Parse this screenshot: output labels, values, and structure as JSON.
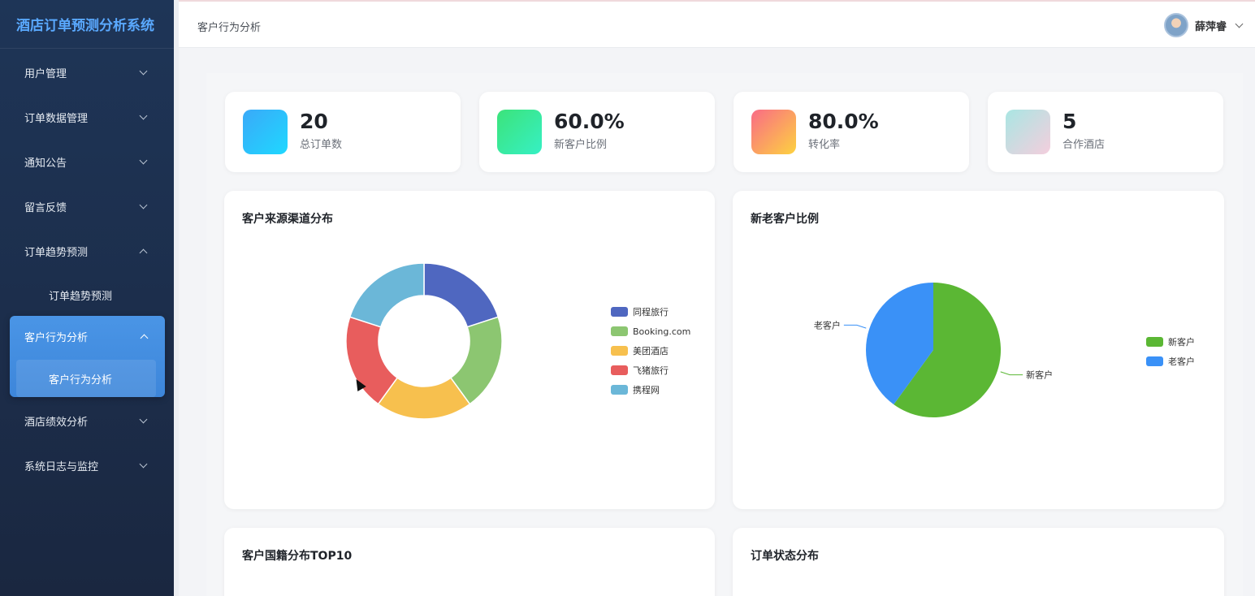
{
  "app": {
    "title": "酒店订单预测分析系统"
  },
  "sidebar": {
    "items": [
      {
        "label": "用户管理"
      },
      {
        "label": "订单数据管理"
      },
      {
        "label": "通知公告"
      },
      {
        "label": "留言反馈"
      },
      {
        "label": "订单趋势预测",
        "sub": "订单趋势预测"
      },
      {
        "label": "客户行为分析",
        "sub": "客户行为分析"
      },
      {
        "label": "酒店绩效分析"
      },
      {
        "label": "系统日志与监控"
      }
    ]
  },
  "header": {
    "breadcrumb": "客户行为分析",
    "user_name": "薛萍睿"
  },
  "stats": [
    {
      "value": "20",
      "label": "总订单数",
      "gradient": [
        "#3aa9f8",
        "#1fd8ff"
      ]
    },
    {
      "value": "60.0%",
      "label": "新客户比例",
      "gradient": [
        "#3ce37a",
        "#36f0c4"
      ]
    },
    {
      "value": "80.0%",
      "label": "转化率",
      "gradient": [
        "#f96b86",
        "#fdd240"
      ]
    },
    {
      "value": "5",
      "label": "合作酒店",
      "gradient": [
        "#a9e6e3",
        "#f4cedd"
      ]
    }
  ],
  "cards": {
    "channel": {
      "title": "客户来源渠道分布"
    },
    "newold": {
      "title": "新老客户比例"
    },
    "nationality": {
      "title": "客户国籍分布TOP10"
    },
    "status": {
      "title": "订单状态分布"
    }
  },
  "chart_data": [
    {
      "type": "pie",
      "title": "客户来源渠道分布",
      "donut": true,
      "categories": [
        "同程旅行",
        "Booking.com",
        "美团酒店",
        "飞猪旅行",
        "携程网"
      ],
      "values": [
        4,
        4,
        4,
        4,
        4
      ],
      "colors": [
        "#4f67c0",
        "#8cc671",
        "#f7c04e",
        "#e85d5d",
        "#6bb7d8"
      ],
      "legend": "right"
    },
    {
      "type": "pie",
      "title": "新老客户比例",
      "categories": [
        "新客户",
        "老客户"
      ],
      "values": [
        60,
        40
      ],
      "colors": [
        "#5bb734",
        "#3a91f7"
      ],
      "legend": "right"
    }
  ]
}
